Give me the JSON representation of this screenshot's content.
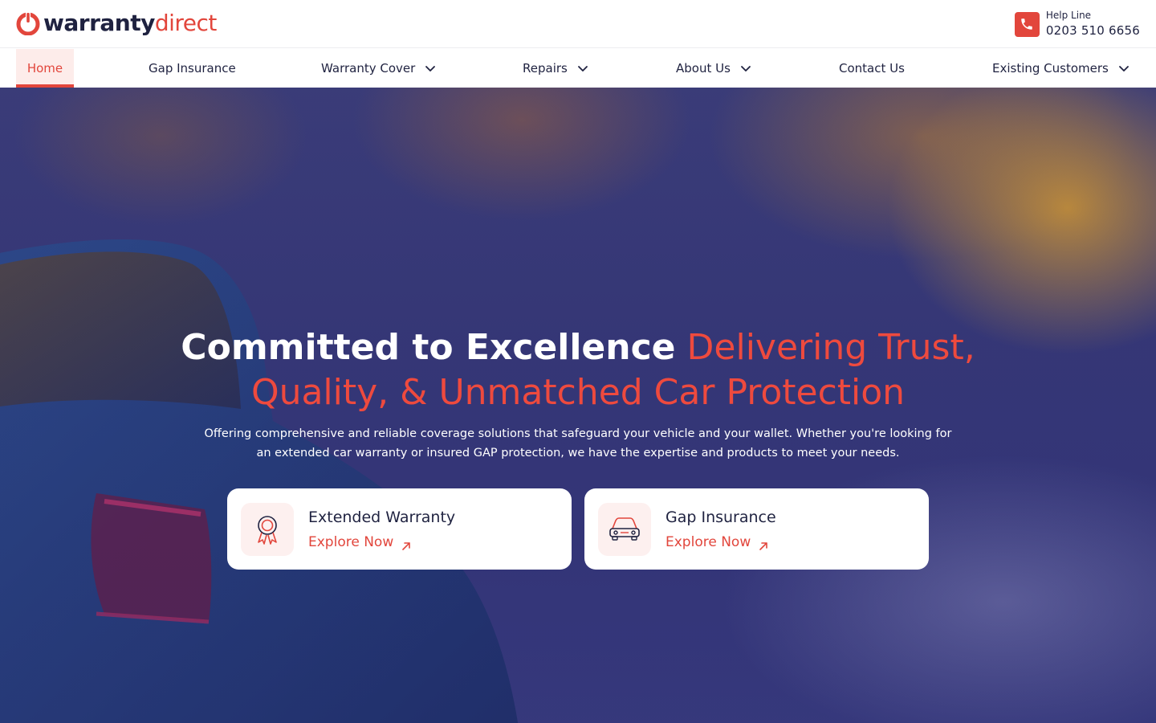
{
  "header": {
    "logo_word1": "warranty",
    "logo_word2": "direct",
    "help_label": "Help Line",
    "help_phone": "0203 510 6656"
  },
  "nav": {
    "home": "Home",
    "gap": "Gap Insurance",
    "warranty": "Warranty Cover",
    "repairs": "Repairs",
    "about": "About Us",
    "contact": "Contact Us",
    "existing": "Existing Customers"
  },
  "hero": {
    "title_white": "Committed to Excellence",
    "title_red_1": "Delivering Trust,",
    "title_red_2": "Quality, & Unmatched Car Protection",
    "subtitle": "Offering comprehensive and reliable coverage solutions that safeguard your vehicle and your wallet. Whether you're looking for an extended car warranty or insured GAP protection, we have the expertise and products to meet your needs."
  },
  "cards": {
    "extended": {
      "title": "Extended Warranty",
      "link": "Explore Now"
    },
    "gap": {
      "title": "Gap Insurance",
      "link": "Explore Now"
    }
  },
  "icons": {
    "logo": "warranty-shield-logo-icon",
    "phone": "phone-icon",
    "chevron": "chevron-down-icon",
    "award": "award-ribbon-icon",
    "car": "car-icon",
    "arrow": "arrow-up-right-icon"
  },
  "colors": {
    "brand_red": "#e2463c",
    "brand_navy": "#1f2240",
    "nav_active_bg": "#fdecea"
  }
}
